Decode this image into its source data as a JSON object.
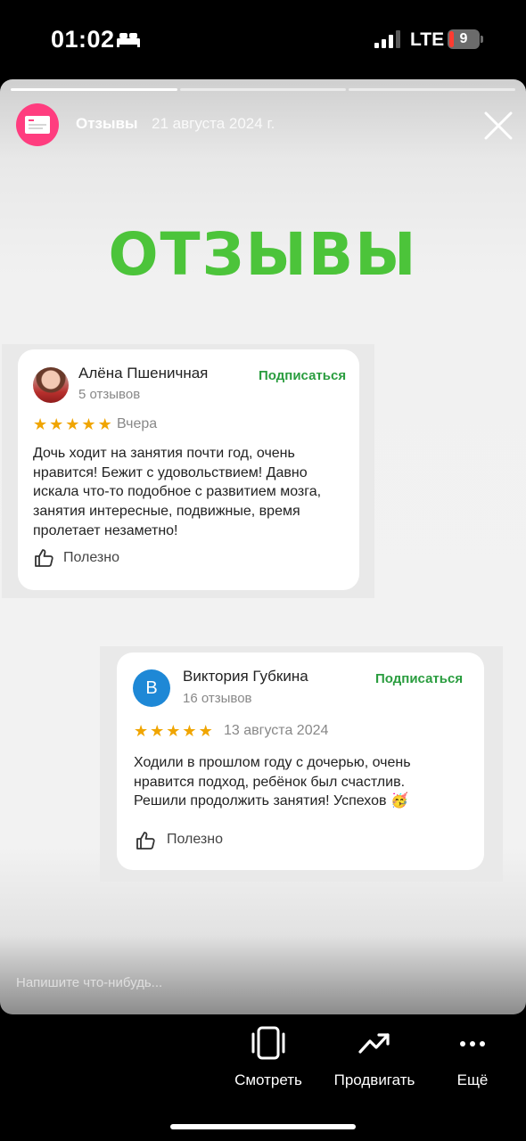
{
  "status_bar": {
    "time": "01:02",
    "network": "LTE",
    "battery": "9",
    "icons": [
      "bed-icon",
      "signal-icon",
      "battery-icon"
    ]
  },
  "story": {
    "progress": {
      "segments": 3,
      "viewed": 1
    },
    "author": "Отзывы",
    "date": "21 августа 2024 г.",
    "headline": "ОТЗЫВЫ",
    "compose_placeholder": "Напишите что-нибудь..."
  },
  "reviews": [
    {
      "name": "Алёна Пшеничная",
      "count": "5 отзывов",
      "subscribe": "Подписаться",
      "rating": 5,
      "date": "Вчера",
      "text_lines": [
        "Дочь ходит на занятия почти год, очень",
        "нравится! Бежит с удовольствием! Давно",
        "искала что-то подобное с развитием мозга,",
        "занятия интересные, подвижные, время",
        "пролетает незаметно!"
      ],
      "helpful": "Полезно"
    },
    {
      "name": "Виктория Губкина",
      "avatar_letter": "В",
      "count": "16 отзывов",
      "subscribe": "Подписаться",
      "rating": 5,
      "date": "13 августа 2024",
      "text_lines": [
        "Ходили в прошлом году с дочерью, очень",
        "нравится подход, ребёнок был счастлив.",
        "Решили продолжить занятия! Успехов 🥳"
      ],
      "helpful": "Полезно"
    }
  ],
  "actions": [
    {
      "label": "Смотреть",
      "icon": "preview-icon"
    },
    {
      "label": "Продвигать",
      "icon": "trending-up-icon"
    },
    {
      "label": "Ещё",
      "icon": "more-icon"
    }
  ],
  "colors": {
    "headline": "#4cc43a",
    "subscribe": "#2a9d3f",
    "stars": "#f0a500",
    "avatar_story": "#ff3d7f",
    "avatar_letter": "#1e88d6"
  }
}
